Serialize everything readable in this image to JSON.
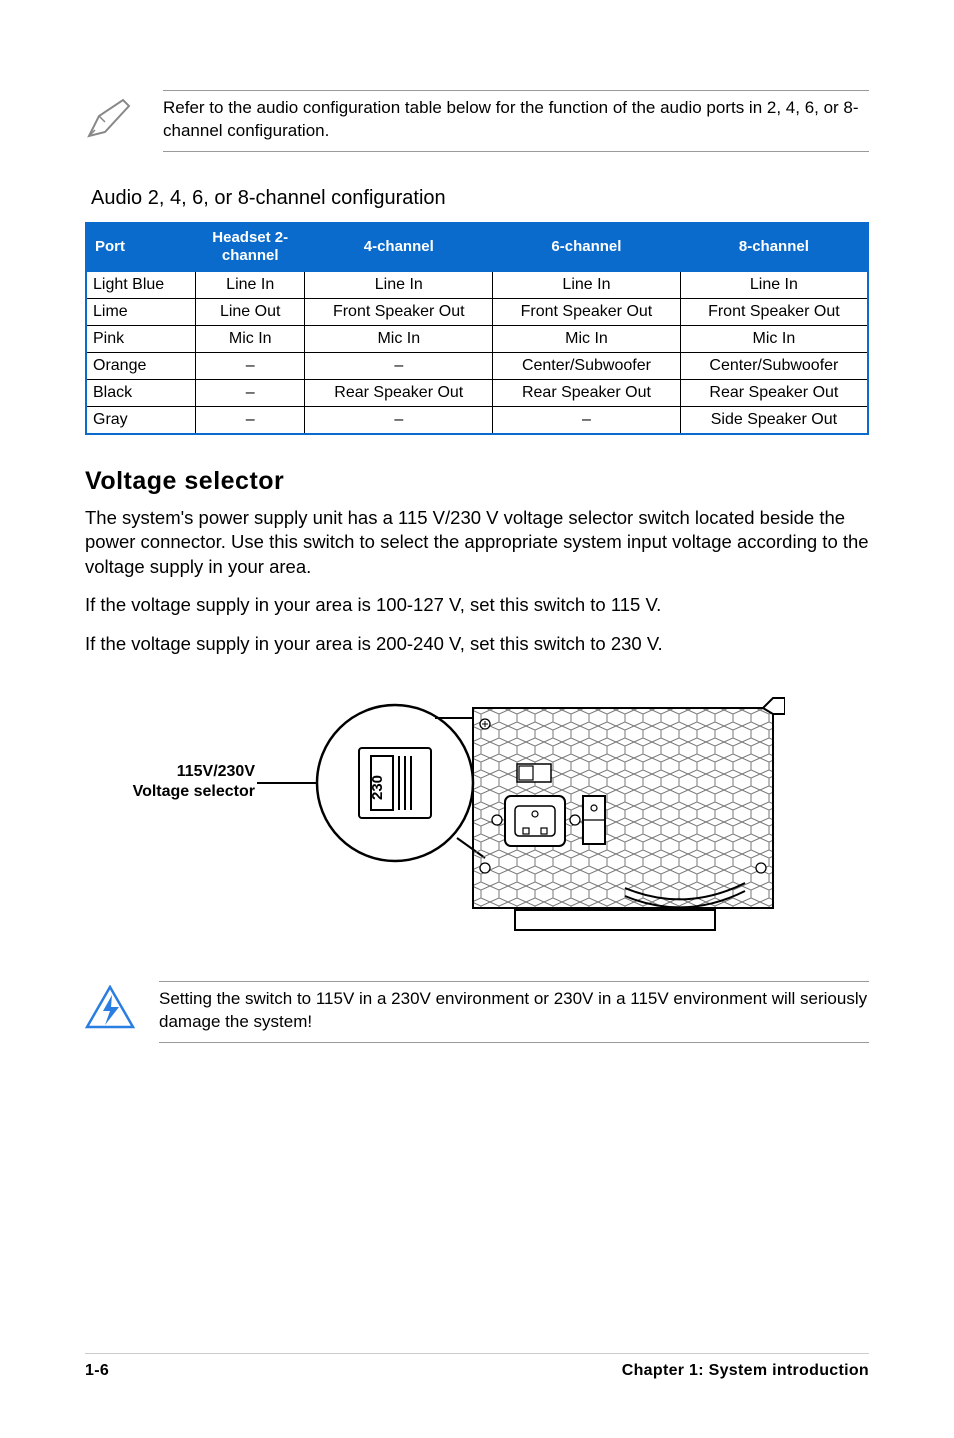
{
  "note": {
    "text": "Refer to the audio configuration table below for the function of the audio ports in 2, 4, 6, or 8-channel configuration."
  },
  "audio_table": {
    "caption": "Audio 2, 4, 6, or 8-channel configuration",
    "headers": {
      "port": "Port",
      "h2": "Headset 2-channel",
      "h4": "4-channel",
      "h6": "6-channel",
      "h8": "8-channel"
    },
    "rows": [
      {
        "port": "Light Blue",
        "c2": "Line In",
        "c4": "Line In",
        "c6": "Line In",
        "c8": "Line In"
      },
      {
        "port": "Lime",
        "c2": "Line Out",
        "c4": "Front Speaker Out",
        "c6": "Front Speaker Out",
        "c8": "Front Speaker Out"
      },
      {
        "port": "Pink",
        "c2": "Mic In",
        "c4": "Mic In",
        "c6": "Mic In",
        "c8": "Mic In"
      },
      {
        "port": "Orange",
        "c2": "–",
        "c4": "–",
        "c6": "Center/Subwoofer",
        "c8": "Center/Subwoofer"
      },
      {
        "port": "Black",
        "c2": "–",
        "c4": "Rear Speaker Out",
        "c6": "Rear Speaker Out",
        "c8": "Rear Speaker Out"
      },
      {
        "port": "Gray",
        "c2": "–",
        "c4": "–",
        "c6": "–",
        "c8": "Side Speaker Out"
      }
    ]
  },
  "voltage_selector": {
    "heading": "Voltage selector",
    "p1": "The system's power supply unit has a 115 V/230 V voltage selector switch located beside the power connector. Use this switch to select the appropriate system input voltage according to the voltage supply in your area.",
    "p2": "If the voltage supply in your area is 100-127 V, set this switch to 115 V.",
    "p3": "If the voltage supply in your area is 200-240 V, set this switch to 230 V.",
    "label_line1": "115V/230V",
    "label_line2": "Voltage selector",
    "switch_value": "230"
  },
  "warning": {
    "text": "Setting the switch to 115V in a 230V environment or 230V in a 115V environment will seriously damage the system!"
  },
  "footer": {
    "page": "1-6",
    "chapter": "Chapter 1: System introduction"
  }
}
